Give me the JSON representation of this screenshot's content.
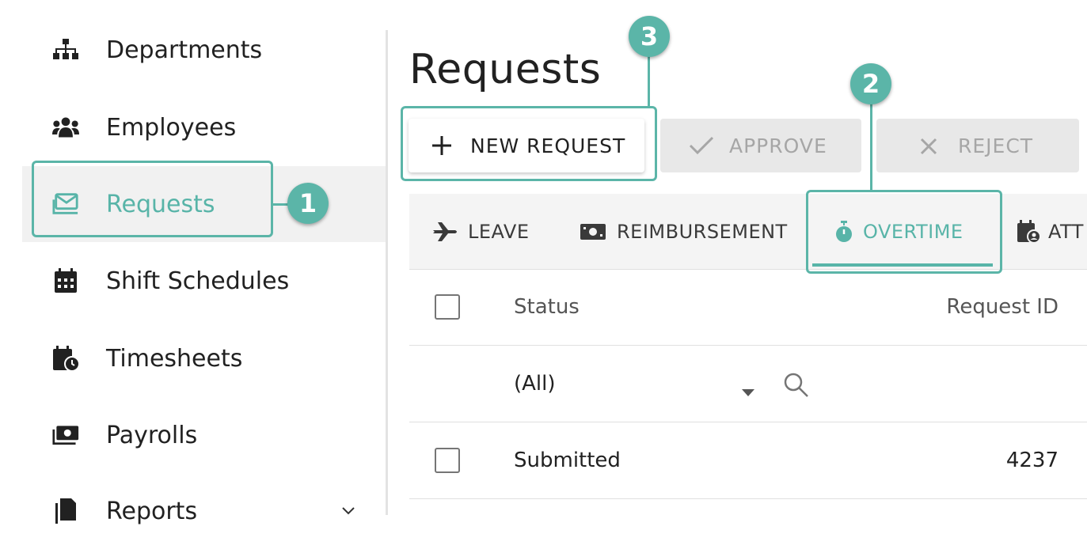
{
  "sidebar": {
    "items": [
      {
        "label": "Departments",
        "icon": "sitemap-icon"
      },
      {
        "label": "Employees",
        "icon": "users-icon"
      },
      {
        "label": "Requests",
        "icon": "envelope-icon",
        "active": true
      },
      {
        "label": "Shift Schedules",
        "icon": "calendar-icon"
      },
      {
        "label": "Timesheets",
        "icon": "calendar-clock-icon"
      },
      {
        "label": "Payrolls",
        "icon": "money-bill-icon"
      },
      {
        "label": "Reports",
        "icon": "file-icon"
      }
    ]
  },
  "page": {
    "title": "Requests"
  },
  "toolbar": {
    "new_label": "NEW REQUEST",
    "approve_label": "APPROVE",
    "reject_label": "REJECT"
  },
  "tabs": [
    {
      "label": "LEAVE",
      "icon": "plane-icon"
    },
    {
      "label": "REIMBURSEMENT",
      "icon": "money-icon"
    },
    {
      "label": "OVERTIME",
      "icon": "stopwatch-icon",
      "active": true
    },
    {
      "label": "ATT",
      "icon": "calendar-user-icon"
    }
  ],
  "grid": {
    "columns": [
      "Status",
      "Request ID"
    ],
    "filter": {
      "value": "(All)"
    },
    "rows": [
      {
        "status": "Submitted",
        "request_id": "4237"
      }
    ]
  },
  "annotations": [
    "1",
    "2",
    "3"
  ],
  "colors": {
    "accent": "#5bb5a8",
    "active_bg": "#f1f1f1",
    "disabled_bg": "#e8e8e8"
  }
}
